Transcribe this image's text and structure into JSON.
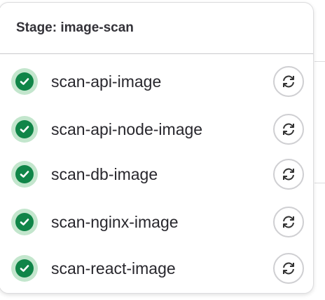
{
  "header": {
    "title": "Stage: image-scan"
  },
  "jobs": [
    {
      "name": "scan-api-image",
      "status": "success",
      "action": "retry"
    },
    {
      "name": "scan-api-node-image",
      "status": "success",
      "action": "retry"
    },
    {
      "name": "scan-db-image",
      "status": "success",
      "action": "retry"
    },
    {
      "name": "scan-nginx-image",
      "status": "success",
      "action": "retry"
    },
    {
      "name": "scan-react-image",
      "status": "success",
      "action": "retry"
    }
  ],
  "colors": {
    "success": "#108548",
    "success_ring": "#c3e6cd"
  }
}
